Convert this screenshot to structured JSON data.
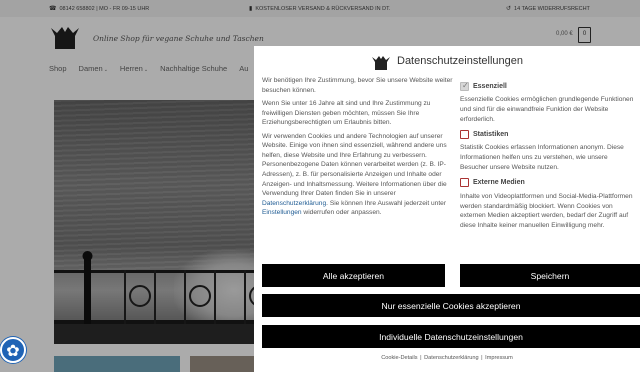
{
  "topbar": {
    "phone": "08142 658802 | MO - FR 09-15 UHR",
    "shipping": "KOSTENLOSER VERSAND & RÜCKVERSAND IN DT.",
    "returns": "14 TAGE WIDERRUFSRECHT"
  },
  "header": {
    "tagline": "Online Shop für vegane Schuhe und Taschen",
    "cart_total": "0,00 €",
    "cart_count": "0"
  },
  "nav": {
    "items": [
      {
        "label": "Shop"
      },
      {
        "label": "Damen"
      },
      {
        "label": "Herren"
      },
      {
        "label": "Nachhaltige Schuhe"
      },
      {
        "label": "Au"
      }
    ]
  },
  "modal": {
    "title": "Datenschutzeinstellungen",
    "p1": "Wir benötigen Ihre Zustimmung, bevor Sie unsere Website weiter besuchen können.",
    "p2": "Wenn Sie unter 16 Jahre alt sind und Ihre Zustimmung zu freiwilligen Diensten geben möchten, müssen Sie Ihre Erziehungsberechtigten um Erlaubnis bitten.",
    "p3_a": "Wir verwenden Cookies und andere Technologien auf unserer Website. Einige von ihnen sind essenziell, während andere uns helfen, diese Website und Ihre Erfahrung zu verbessern. Personenbezogene Daten können verarbeitet werden (z. B. IP-Adressen), z. B. für personalisierte Anzeigen und Inhalte oder Anzeigen- und Inhaltsmessung. Weitere Informationen über die Verwendung Ihrer Daten finden Sie in unserer ",
    "p3_link1": "Datenschutzerklärung",
    "p3_b": ". Sie können Ihre Auswahl jederzeit unter ",
    "p3_link2": "Einstellungen",
    "p3_c": " widerrufen oder anpassen.",
    "options": [
      {
        "title": "Essenziell",
        "checked": true,
        "desc": "Essenzielle Cookies ermöglichen grundlegende Funktionen und sind für die einwandfreie Funktion der Website erforderlich."
      },
      {
        "title": "Statistiken",
        "checked": false,
        "desc": "Statistik Cookies erfassen Informationen anonym. Diese Informationen helfen uns zu verstehen, wie unsere Besucher unsere Website nutzen."
      },
      {
        "title": "Externe Medien",
        "checked": false,
        "desc": "Inhalte von Videoplattformen und Social-Media-Plattformen werden standardmäßig blockiert. Wenn Cookies von externen Medien akzeptiert werden, bedarf der Zugriff auf diese Inhalte keiner manuellen Einwilligung mehr."
      }
    ],
    "btn_accept_all": "Alle akzeptieren",
    "btn_save": "Speichern",
    "btn_essential": "Nur essenzielle Cookies akzeptieren",
    "btn_custom": "Individuelle Datenschutzeinstellungen",
    "footer_details": "Cookie-Details",
    "footer_privacy": "Datenschutzerklärung",
    "footer_imprint": "Impressum",
    "footer_sep": "|"
  },
  "icons": {
    "phone": "phone-icon",
    "truck": "truck-icon",
    "return": "return-icon",
    "badge": "cookie-settings-icon"
  },
  "colors": {
    "button_bg": "#000000",
    "link": "#1e5b93",
    "badge": "#1f63b5"
  }
}
